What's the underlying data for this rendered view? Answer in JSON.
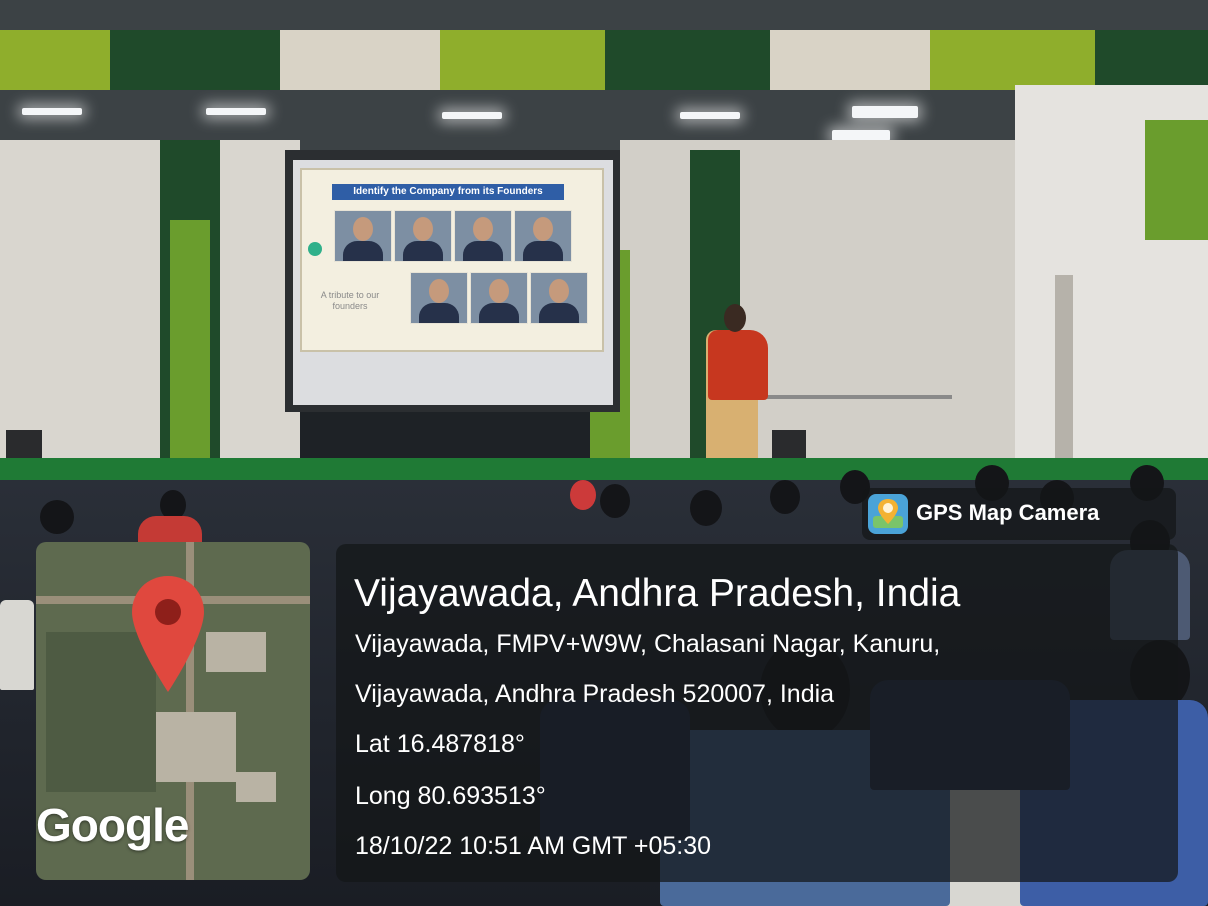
{
  "slide": {
    "title": "Identify the Company from its Founders",
    "tribute": "A tribute to our founders"
  },
  "overlay": {
    "app_label": "GPS Map Camera",
    "map_logo": "Google",
    "location_title": "Vijayawada, Andhra Pradesh, India",
    "address_line_1": "Vijayawada, FMPV+W9W, Chalasani Nagar, Kanuru,",
    "address_line_2": "Vijayawada, Andhra Pradesh 520007, India",
    "latitude": "Lat 16.487818°",
    "longitude": "Long 80.693513°",
    "datetime": "18/10/22 10:51 AM GMT +05:30",
    "icons": {
      "app": "gps-camera-icon",
      "map_pin": "map-pin-icon"
    },
    "colors": {
      "pin": "#e0483e",
      "card": "#16181a"
    }
  }
}
